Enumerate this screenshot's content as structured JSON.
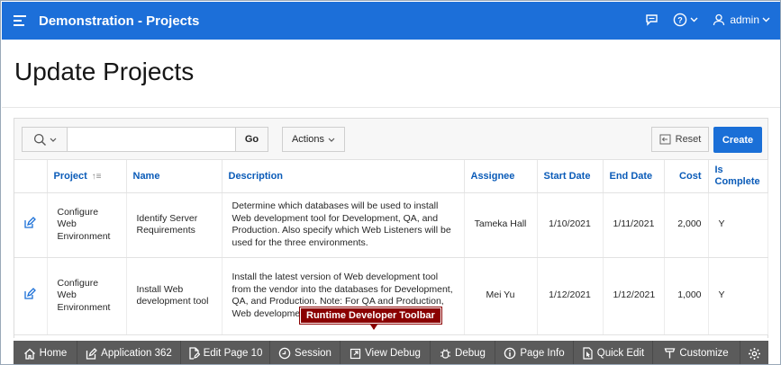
{
  "header": {
    "app_title": "Demonstration - Projects",
    "user": "admin"
  },
  "page": {
    "title": "Update Projects"
  },
  "toolbar": {
    "go_label": "Go",
    "actions_label": "Actions",
    "reset_label": "Reset",
    "create_label": "Create",
    "search_value": ""
  },
  "table": {
    "columns": [
      "Project",
      "Name",
      "Description",
      "Assignee",
      "Start Date",
      "End Date",
      "Cost",
      "Is Complete"
    ],
    "rows": [
      {
        "project": "Configure Web Environment",
        "name": "Identify Server Requirements",
        "description": "Determine which databases will be used to install Web development tool for Development, QA, and Production. Also specify which Web Listeners will be used for the three environments.",
        "assignee": "Tameka Hall",
        "start": "1/10/2021",
        "end": "1/11/2021",
        "cost": "2,000",
        "complete": "Y"
      },
      {
        "project": "Configure Web Environment",
        "name": "Install Web development tool",
        "description": "Install the latest version of Web development tool from the vendor into the databases for Development, QA, and Production. Note: For QA and Production, Web development tool should be configured as \"r",
        "assignee": "Mei Yu",
        "start": "1/12/2021",
        "end": "1/12/2021",
        "cost": "1,000",
        "complete": "Y"
      }
    ]
  },
  "tooltip": {
    "text": "Runtime Developer Toolbar"
  },
  "devbar": {
    "items": [
      "Home",
      "Application 362",
      "Edit Page 10",
      "Session",
      "View Debug",
      "Debug",
      "Page Info",
      "Quick Edit",
      "Customize"
    ]
  },
  "colors": {
    "header": "#1c6fd9",
    "create": "#1a6fd7",
    "devbar": "#5b5b5b",
    "tooltip": "#8a0000",
    "link": "#0a5bb8"
  }
}
